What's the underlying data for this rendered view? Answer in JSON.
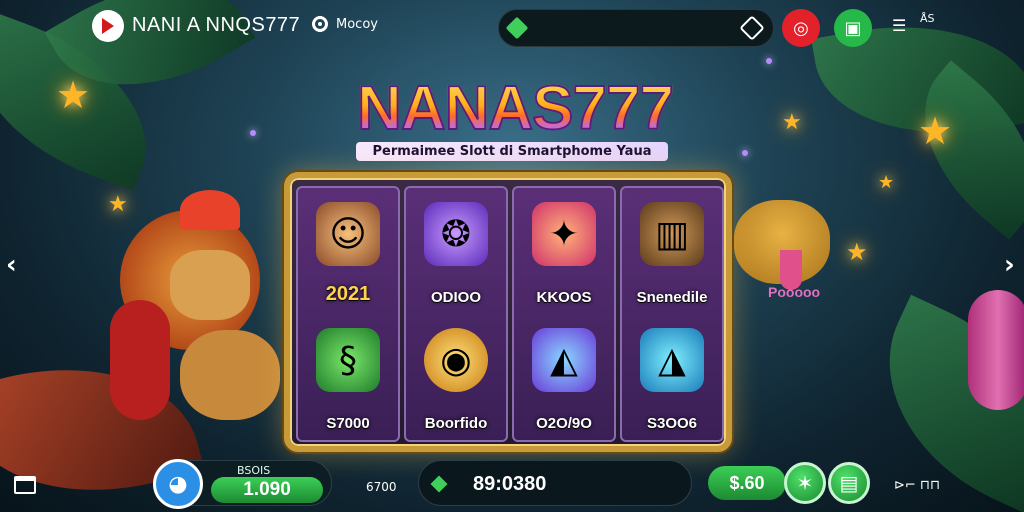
{
  "header": {
    "brand": "NANI A NNQS777",
    "menu_label": "Mocoy",
    "status_label": "ÅS"
  },
  "hero": {
    "title": "NANAS777",
    "subtitle": "Permaimee Slott di Smartphome Yaua"
  },
  "reels": [
    {
      "top": {
        "icon": "boy-face-icon",
        "label": "2021",
        "style": "gold"
      },
      "bottom": {
        "icon": "snake-icon",
        "label": "S7000"
      }
    },
    {
      "top": {
        "icon": "fish-creature-icon",
        "label": "ODIOO"
      },
      "bottom": {
        "icon": "gold-coin-icon",
        "label": "Boorfido"
      }
    },
    {
      "top": {
        "icon": "scroll-icon",
        "label": "KKOOS"
      },
      "bottom": {
        "icon": "dolphin-icon",
        "label": "O2O/9O"
      }
    },
    {
      "top": {
        "icon": "barrel-icon",
        "label": "Snenedile"
      },
      "bottom": {
        "icon": "shoe-icon",
        "label": "S3OO6"
      }
    }
  ],
  "side_creature_label": "Pooooo",
  "footer": {
    "balance_caption": "BSOIS",
    "balance": "1.090",
    "small_value": "6700",
    "center_value": "89:0380",
    "bet": "$.60",
    "tail_text": "⊳⌐ ⊓⊓"
  },
  "colors": {
    "accent_green": "#27b84a",
    "accent_red": "#e3212b",
    "frame_gold": "#c79a3a"
  }
}
